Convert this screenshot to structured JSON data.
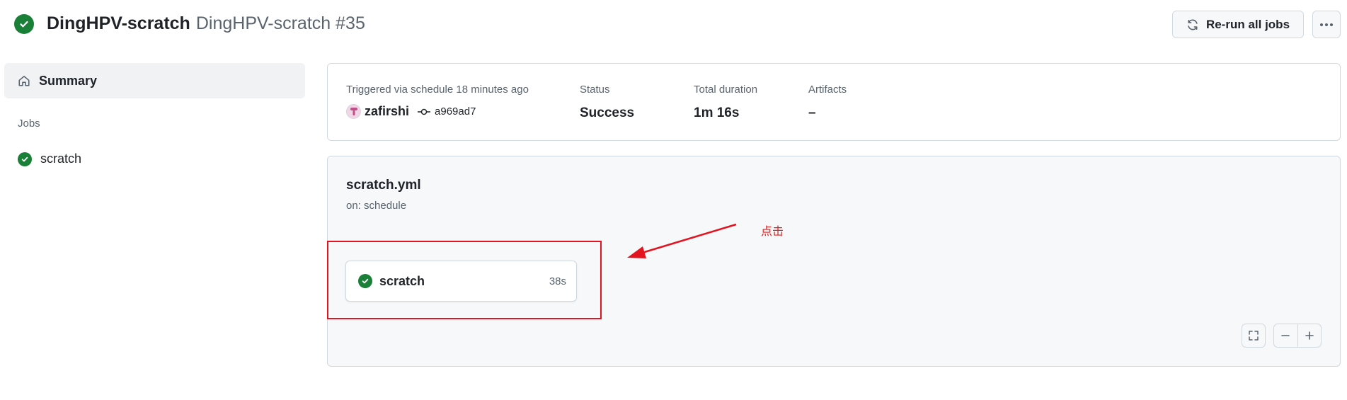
{
  "header": {
    "workflow_name": "DingHPV-scratch",
    "run_title": "DingHPV-scratch #35",
    "rerun_label": "Re-run all jobs"
  },
  "sidebar": {
    "summary_label": "Summary",
    "jobs_heading": "Jobs",
    "jobs": [
      {
        "label": "scratch"
      }
    ]
  },
  "run_info": {
    "trigger_text": "Triggered via schedule 18 minutes ago",
    "actor": "zafirshi",
    "commit": "a969ad7",
    "status_label": "Status",
    "status_value": "Success",
    "duration_label": "Total duration",
    "duration_value": "1m 16s",
    "artifacts_label": "Artifacts",
    "artifacts_value": "–"
  },
  "workflow_graph": {
    "file_name": "scratch.yml",
    "trigger": "on: schedule",
    "jobs": [
      {
        "name": "scratch",
        "duration": "38s",
        "status": "success"
      }
    ]
  },
  "annotation": {
    "text": "点击",
    "color": "#e3141f"
  },
  "colors": {
    "success": "#1a7f37",
    "border": "#d1d9e0",
    "muted_text": "#59636e",
    "panel_bg": "#f6f8fa"
  },
  "icons": {
    "header_status": "check-circle-icon",
    "rerun": "sync-icon",
    "more": "kebab-horizontal-icon",
    "summary": "home-icon",
    "commit": "git-commit-icon",
    "fullscreen": "screen-full-icon",
    "zoom_out": "minus-icon",
    "zoom_in": "plus-icon"
  }
}
